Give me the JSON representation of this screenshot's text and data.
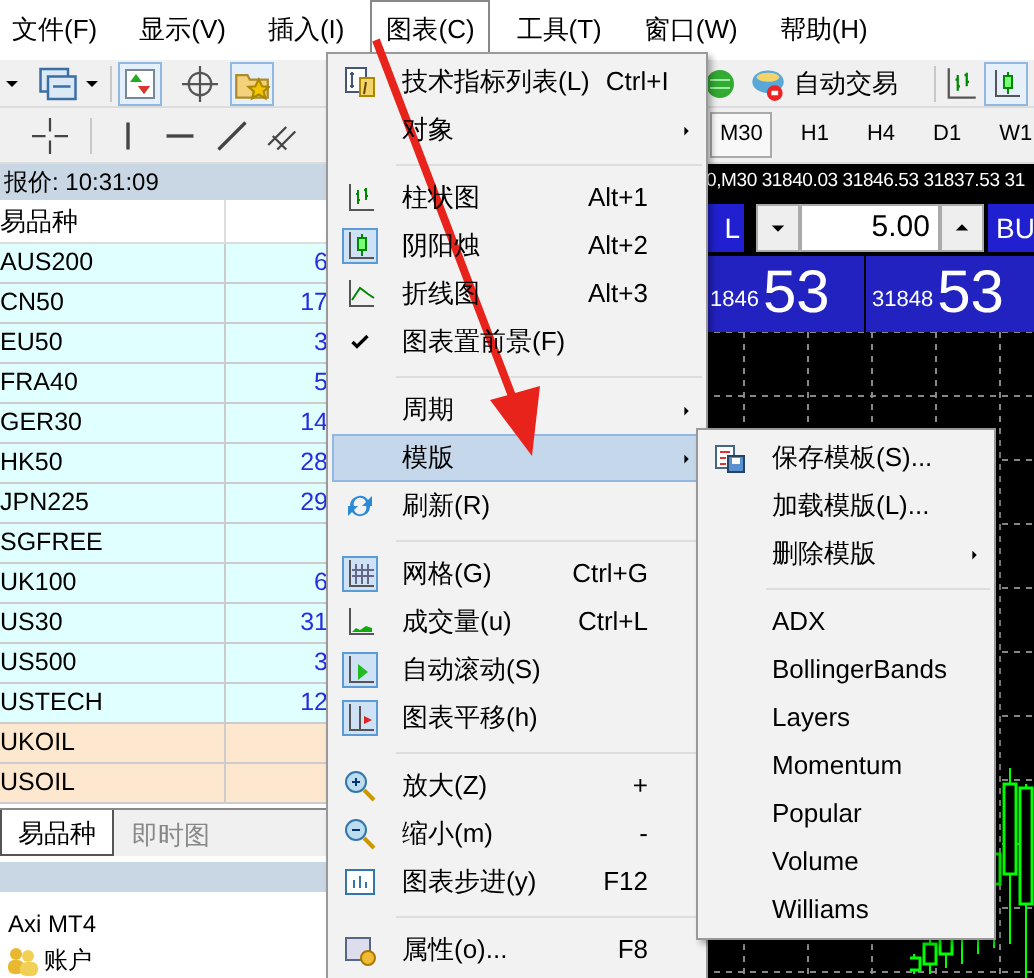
{
  "menu_bar": [
    {
      "label": "文件(F)",
      "selected": false
    },
    {
      "label": "显示(V)",
      "selected": false
    },
    {
      "label": "插入(I)",
      "selected": false
    },
    {
      "label": "图表(C)",
      "selected": true
    },
    {
      "label": "工具(T)",
      "selected": false
    },
    {
      "label": "窗口(W)",
      "selected": false
    },
    {
      "label": "帮助(H)",
      "selected": false
    }
  ],
  "toolbar": {
    "auto_trading": "自动交易"
  },
  "timeframes": [
    {
      "label": "M30",
      "selected": true
    },
    {
      "label": "H1",
      "selected": false
    },
    {
      "label": "H4",
      "selected": false
    },
    {
      "label": "D1",
      "selected": false
    },
    {
      "label": "W1",
      "selected": false
    }
  ],
  "market_watch": {
    "title": "报价: 10:31:09",
    "column": "易品种",
    "rows": [
      {
        "symbol": "AUS200",
        "value": "6",
        "kind": "index"
      },
      {
        "symbol": "CN50",
        "value": "17",
        "kind": "index"
      },
      {
        "symbol": "EU50",
        "value": "3",
        "kind": "index"
      },
      {
        "symbol": "FRA40",
        "value": "5",
        "kind": "index"
      },
      {
        "symbol": "GER30",
        "value": "14",
        "kind": "index"
      },
      {
        "symbol": "HK50",
        "value": "28",
        "kind": "index"
      },
      {
        "symbol": "JPN225",
        "value": "29",
        "kind": "index"
      },
      {
        "symbol": "SGFREE",
        "kind": "index"
      },
      {
        "symbol": "UK100",
        "value": "6",
        "kind": "index"
      },
      {
        "symbol": "US30",
        "value": "31",
        "kind": "index"
      },
      {
        "symbol": "US500",
        "value": "3",
        "kind": "index"
      },
      {
        "symbol": "USTECH",
        "value": "12",
        "kind": "index"
      },
      {
        "symbol": "UKOIL",
        "kind": "commodity"
      },
      {
        "symbol": "USOIL",
        "kind": "commodity"
      }
    ]
  },
  "tabs": [
    {
      "label": "易品种",
      "selected": true
    },
    {
      "label": "即时图",
      "selected": false
    }
  ],
  "navigator": {
    "items": [
      "Axi MT4",
      "账户"
    ]
  },
  "chart": {
    "info": "0,M30 31840.03 31846.53 31837.53 31",
    "sell": "L",
    "lot": "5.00",
    "buy": "BU",
    "sell_small": "1846",
    "sell_big": "53",
    "buy_small": "31848",
    "buy_big": "53"
  },
  "chart_menu": [
    {
      "kind": "item",
      "label": "技术指标列表(L)",
      "shortcut": "Ctrl+I"
    },
    {
      "kind": "item",
      "label": "对象",
      "submenu": true
    },
    {
      "kind": "separator"
    },
    {
      "kind": "item",
      "label": "柱状图",
      "shortcut": "Alt+1",
      "checked": false
    },
    {
      "kind": "item",
      "label": "阴阳烛",
      "shortcut": "Alt+2",
      "checked": true
    },
    {
      "kind": "item",
      "label": "折线图",
      "shortcut": "Alt+3",
      "checked": false
    },
    {
      "kind": "item",
      "label": "图表置前景(F)",
      "checked": true
    },
    {
      "kind": "separator"
    },
    {
      "kind": "item",
      "label": "周期",
      "submenu": true
    },
    {
      "kind": "item",
      "label": "模版",
      "submenu": true,
      "selected": true
    },
    {
      "kind": "item",
      "label": "刷新(R)"
    },
    {
      "kind": "separator"
    },
    {
      "kind": "item",
      "label": "网格(G)",
      "shortcut": "Ctrl+G",
      "checked": true
    },
    {
      "kind": "item",
      "label": "成交量(u)",
      "shortcut": "Ctrl+L",
      "checked": false
    },
    {
      "kind": "item",
      "label": "自动滚动(S)",
      "checked": true
    },
    {
      "kind": "item",
      "label": "图表平移(h)",
      "checked": true
    },
    {
      "kind": "separator"
    },
    {
      "kind": "item",
      "label": "放大(Z)",
      "shortcut": "+"
    },
    {
      "kind": "item",
      "label": "缩小(m)",
      "shortcut": "-"
    },
    {
      "kind": "item",
      "label": "图表步进(y)",
      "shortcut": "F12"
    },
    {
      "kind": "separator"
    },
    {
      "kind": "item",
      "label": "属性(o)...",
      "shortcut": "F8"
    }
  ],
  "template_menu": [
    {
      "kind": "item",
      "label": "保存模板(S)..."
    },
    {
      "kind": "item",
      "label": "加载模版(L)..."
    },
    {
      "kind": "item",
      "label": "删除模版",
      "submenu": true
    },
    {
      "kind": "separator"
    },
    {
      "kind": "item",
      "label": "ADX"
    },
    {
      "kind": "item",
      "label": "BollingerBands"
    },
    {
      "kind": "item",
      "label": "Layers"
    },
    {
      "kind": "item",
      "label": "Momentum"
    },
    {
      "kind": "item",
      "label": "Popular"
    },
    {
      "kind": "item",
      "label": "Volume"
    },
    {
      "kind": "item",
      "label": "Williams"
    }
  ]
}
